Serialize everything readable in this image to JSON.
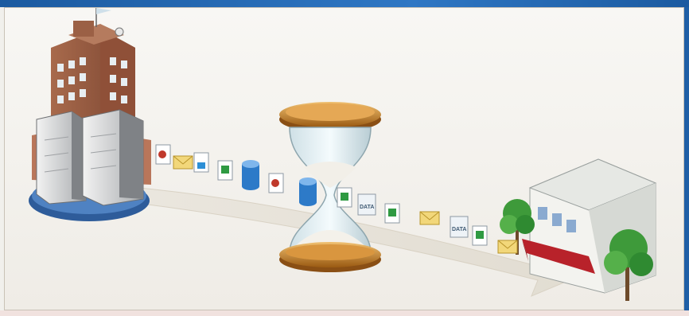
{
  "scene": {
    "data_label": "DATA",
    "icons": [
      "headquarters-building-icon",
      "server-rack-icon",
      "hourglass-icon",
      "retail-store-icon",
      "tree-icon",
      "document-icon",
      "email-icon",
      "spreadsheet-icon",
      "database-icon",
      "data-file-icon"
    ],
    "colors": {
      "frame_blue": "#1f5fa6",
      "flow_arrow": "#e9e4da",
      "hourglass_gold": "#c98a2c",
      "awning_red": "#b8222a"
    }
  }
}
